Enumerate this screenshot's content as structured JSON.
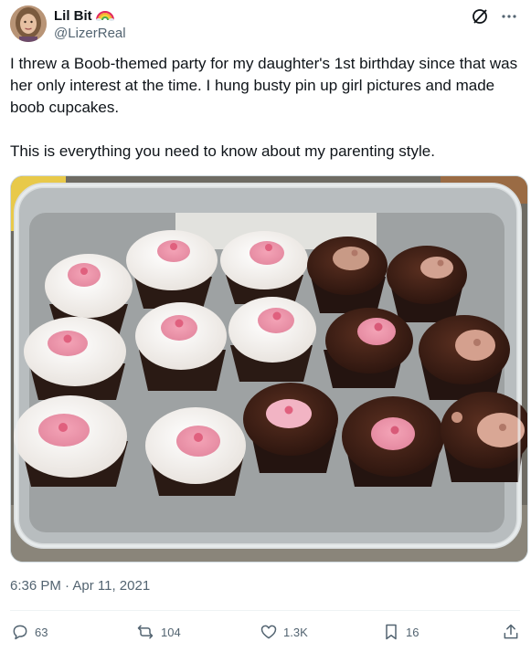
{
  "author": {
    "display_name": "Lil Bit",
    "handle": "@LizerReal",
    "name_emoji": "rainbow-icon"
  },
  "header_actions": {
    "grok_icon": "grok-icon",
    "more_icon": "more-options-icon"
  },
  "tweet": {
    "paragraph_1": "I threw a Boob-themed party for my daughter's 1st birthday since that was her only interest at the time. I hung busty pin up girl pictures and made boob cupcakes.",
    "paragraph_2": "This is everything you need to know about my parenting style."
  },
  "timestamp": {
    "time": "6:36 PM",
    "separator": " · ",
    "date": "Apr 11, 2021"
  },
  "stats": {
    "replies": "63",
    "reposts": "104",
    "likes": "1.3K",
    "bookmarks": "16"
  },
  "colors": {
    "text_primary": "#0f1419",
    "text_secondary": "#536471",
    "border": "#cfd9de"
  }
}
